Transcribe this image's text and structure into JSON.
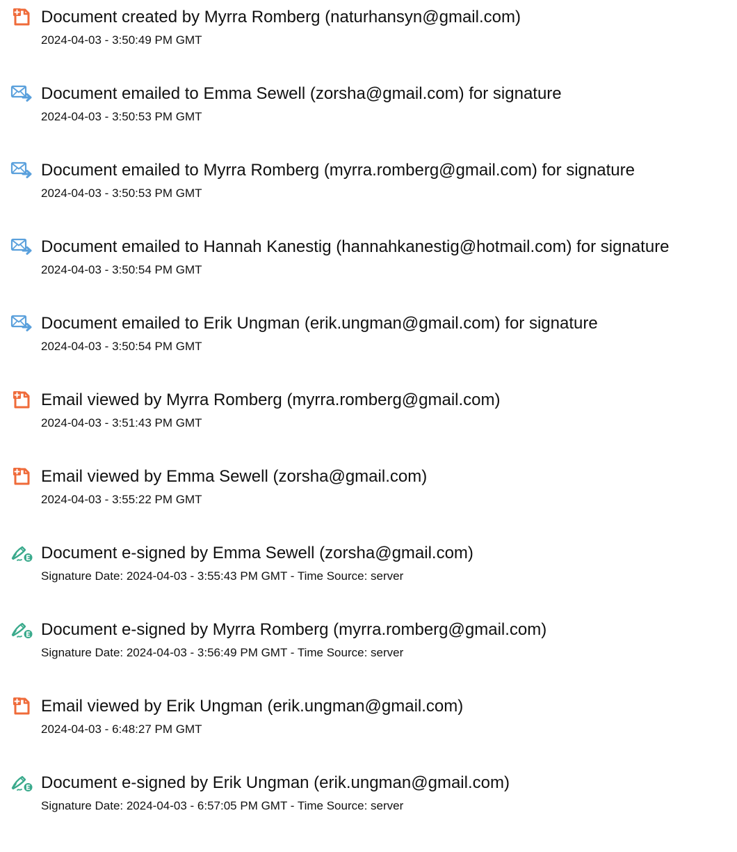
{
  "events": [
    {
      "icon": "document-created-icon",
      "title": "Document created by Myrra Romberg (naturhansyn@gmail.com)",
      "meta": "2024-04-03 - 3:50:49 PM GMT"
    },
    {
      "icon": "email-sent-icon",
      "title": "Document emailed to Emma Sewell (zorsha@gmail.com) for signature",
      "meta": "2024-04-03 - 3:50:53 PM GMT"
    },
    {
      "icon": "email-sent-icon",
      "title": "Document emailed to Myrra Romberg (myrra.romberg@gmail.com) for signature",
      "meta": "2024-04-03 - 3:50:53 PM GMT"
    },
    {
      "icon": "email-sent-icon",
      "title": "Document emailed to Hannah Kanestig (hannahkanestig@hotmail.com) for signature",
      "meta": "2024-04-03 - 3:50:54 PM GMT"
    },
    {
      "icon": "email-sent-icon",
      "title": "Document emailed to Erik Ungman (erik.ungman@gmail.com) for signature",
      "meta": "2024-04-03 - 3:50:54 PM GMT"
    },
    {
      "icon": "document-viewed-icon",
      "title": "Email viewed by Myrra Romberg (myrra.romberg@gmail.com)",
      "meta": "2024-04-03 - 3:51:43 PM GMT"
    },
    {
      "icon": "document-viewed-icon",
      "title": "Email viewed by Emma Sewell (zorsha@gmail.com)",
      "meta": "2024-04-03 - 3:55:22 PM GMT"
    },
    {
      "icon": "e-signature-icon",
      "title": "Document e-signed by Emma Sewell (zorsha@gmail.com)",
      "meta": "Signature Date: 2024-04-03 - 3:55:43 PM GMT - Time Source: server"
    },
    {
      "icon": "e-signature-icon",
      "title": "Document e-signed by Myrra Romberg (myrra.romberg@gmail.com)",
      "meta": "Signature Date: 2024-04-03 - 3:56:49 PM GMT - Time Source: server"
    },
    {
      "icon": "document-viewed-icon",
      "title": "Email viewed by Erik Ungman (erik.ungman@gmail.com)",
      "meta": "2024-04-03 - 6:48:27 PM GMT"
    },
    {
      "icon": "e-signature-icon",
      "title": "Document e-signed by Erik Ungman (erik.ungman@gmail.com)",
      "meta": "Signature Date: 2024-04-03 - 6:57:05 PM GMT - Time Source: server"
    }
  ],
  "colors": {
    "document_icon": "#ef6b3a",
    "email_icon": "#5aa0dc",
    "signature_icon": "#3aaa8c"
  }
}
